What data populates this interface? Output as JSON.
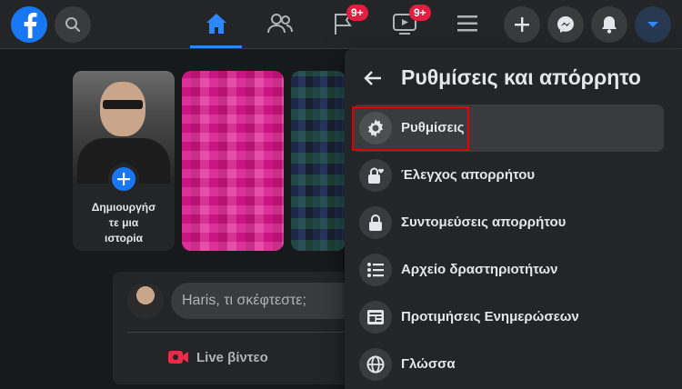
{
  "header": {
    "notification_badges": {
      "pages": "9+",
      "watch": "9+"
    }
  },
  "stories": {
    "create_label_line1": "Δημιουργήσ",
    "create_label_line2": "τε μια",
    "create_label_line3": "ιστορία"
  },
  "composer": {
    "placeholder": "Haris, τι σκέφτεστε;",
    "live_label": "Live βίντεο"
  },
  "menu": {
    "title": "Ρυθμίσεις και απόρρητο",
    "items": [
      {
        "label": "Ρυθμίσεις",
        "icon": "gear-icon"
      },
      {
        "label": "Έλεγχος απορρήτου",
        "icon": "lock-heart-icon"
      },
      {
        "label": "Συντομεύσεις απορρήτου",
        "icon": "lock-icon"
      },
      {
        "label": "Αρχείο δραστηριοτήτων",
        "icon": "list-icon"
      },
      {
        "label": "Προτιμήσεις Ενημερώσεων",
        "icon": "news-feed-icon"
      },
      {
        "label": "Γλώσσα",
        "icon": "globe-icon"
      }
    ]
  },
  "colors": {
    "accent": "#2d88ff",
    "brand": "#1877f2",
    "badge": "#e41e3f",
    "highlight": "#e00000",
    "live": "#f02849"
  }
}
